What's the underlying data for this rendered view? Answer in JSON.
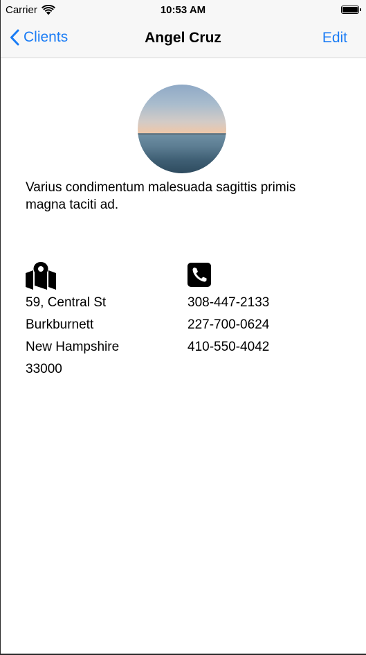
{
  "status_bar": {
    "carrier": "Carrier",
    "time": "10:53 AM"
  },
  "nav": {
    "back_label": "Clients",
    "title": "Angel Cruz",
    "edit_label": "Edit"
  },
  "client": {
    "bio": "Varius condimentum malesuada sagittis primis magna taciti ad.",
    "address": {
      "street": "59, Central St",
      "city": "Burkburnett",
      "state": "New Hampshire",
      "zip": "33000"
    },
    "phones": [
      "308-447-2133",
      "227-700-0624",
      "410-550-4042"
    ]
  },
  "icons": {
    "back": "chevron-left-icon",
    "address": "map-marker-icon",
    "phone": "phone-icon",
    "wifi": "wifi-icon",
    "battery": "battery-icon"
  },
  "colors": {
    "accent": "#1a7cf5",
    "bar_background": "#f7f7f7"
  }
}
